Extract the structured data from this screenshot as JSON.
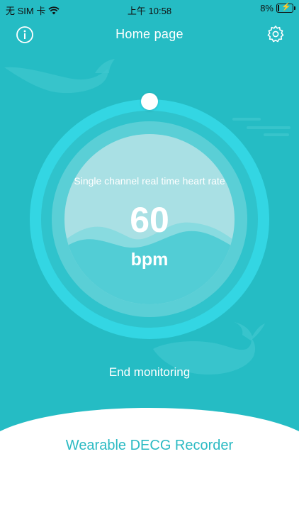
{
  "status_bar": {
    "carrier": "无 SIM 卡",
    "time": "上午 10:58",
    "battery": "8%"
  },
  "nav": {
    "title": "Home page",
    "info_icon": "info-icon",
    "settings_icon": "gear-icon"
  },
  "monitor": {
    "label": "Single channel real time heart rate",
    "value": "60",
    "unit": "bpm"
  },
  "actions": {
    "end_label": "End monitoring"
  },
  "footer": {
    "app_name": "Wearable DECG Recorder"
  },
  "colors": {
    "background": "#25bcc4",
    "ring": "#33d6e3",
    "accent_text": "#2bbac3"
  }
}
